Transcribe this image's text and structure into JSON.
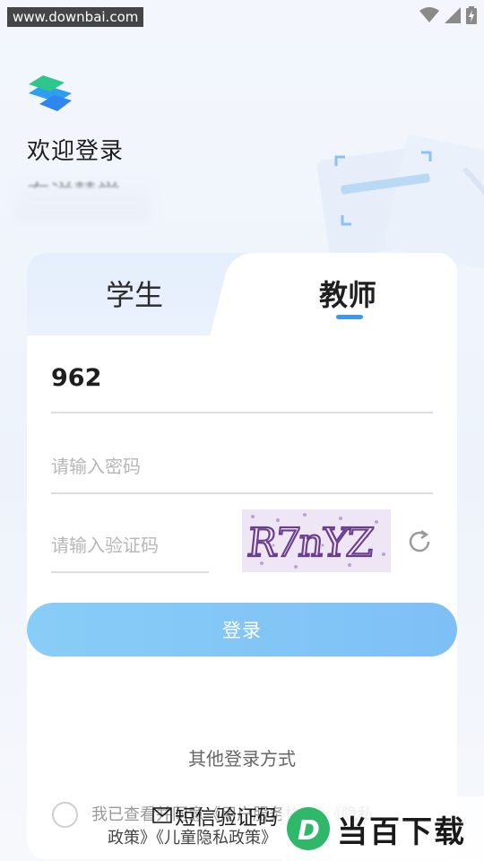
{
  "status_bar": {
    "watermark_url": "www.downbai.com",
    "icons": [
      "wifi-icon",
      "cell-signal-icon",
      "battery-charging-icon"
    ]
  },
  "header": {
    "welcome": "欢迎登录",
    "school_name": "东洋慧学"
  },
  "tabs": [
    {
      "label": "学生",
      "active": false
    },
    {
      "label": "教师",
      "active": true
    }
  ],
  "form": {
    "account_value": "962",
    "password_placeholder": "请输入密码",
    "captcha_placeholder": "请输入验证码",
    "captcha_text": "R7nYZ"
  },
  "login_button": "登录",
  "other_login_label": "其他登录方式",
  "sms_login_label": "短信验证码",
  "agreement": {
    "line1": "我已查看并同意《用户服务协议》《隐私",
    "line2": "政策》《儿童隐私政策》"
  },
  "brand_watermark": "当百下载",
  "colors": {
    "accent": "#3a97f2",
    "login_button": "#85c9f7",
    "background": "#eef3fb"
  }
}
